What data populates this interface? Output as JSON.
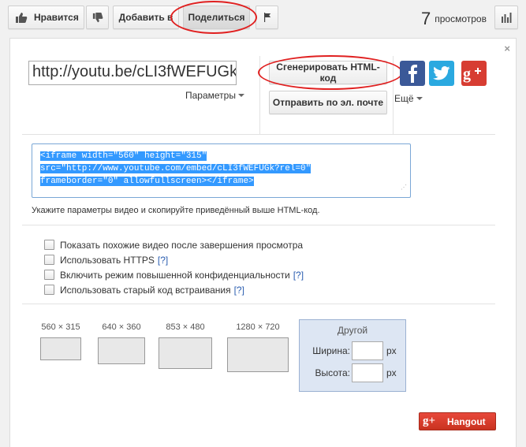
{
  "toolbar": {
    "like_label": "Нравится",
    "add_to_label": "Добавить в",
    "share_label": "Поделиться",
    "views_count": "7",
    "views_label": "просмотров"
  },
  "share": {
    "close": "×",
    "url": "http://youtu.be/cLI3fWEFUGk",
    "params_label": "Параметры",
    "generate_html_label": "Сгенерировать HTML-код",
    "email_label": "Отправить по эл. почте",
    "more_label": "Ещё"
  },
  "embed": {
    "code_line1": "<iframe width=\"560\" height=\"315\"",
    "code_line2": "src=\"http://www.youtube.com/embed/cLI3fWEFUGk?rel=0\"",
    "code_line3": "frameborder=\"0\" allowfullscreen></iframe>",
    "hint": "Укажите параметры видео и скопируйте приведённый выше HTML-код."
  },
  "options": [
    {
      "label": "Показать похожие видео после завершения просмотра",
      "help": ""
    },
    {
      "label": "Использовать HTTPS",
      "help": "[?]"
    },
    {
      "label": "Включить режим повышенной конфиденциальности",
      "help": "[?]"
    },
    {
      "label": "Использовать старый код встраивания",
      "help": "[?]"
    }
  ],
  "sizes": [
    {
      "label": "560 × 315"
    },
    {
      "label": "640 × 360"
    },
    {
      "label": "853 × 480"
    },
    {
      "label": "1280 × 720"
    }
  ],
  "custom_size": {
    "title": "Другой",
    "width_label": "Ширина:",
    "height_label": "Высота:",
    "unit": "px",
    "width_value": "",
    "height_value": ""
  },
  "hangout": {
    "g_mark": "g+",
    "label": "Hangout"
  },
  "colors": {
    "facebook": "#3b5998",
    "twitter": "#2aa9e0",
    "google_plus": "#d73d32",
    "selection": "#3399ff",
    "annotation_ring": "#e02020"
  }
}
